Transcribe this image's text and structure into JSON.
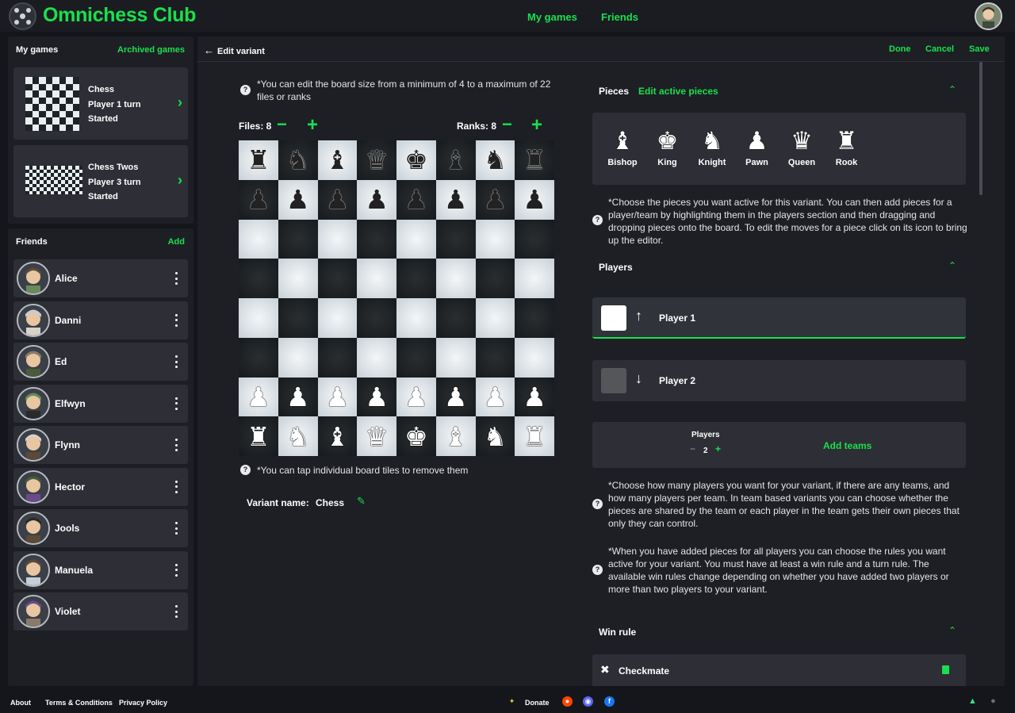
{
  "app": {
    "brand": "Omnichess Club",
    "nav": [
      "My games",
      "Friends"
    ],
    "accent": "#19e04c"
  },
  "my_games": {
    "title": "My games",
    "link": "Archived games",
    "games": [
      {
        "name": "Chess",
        "turn": "Player 1 turn",
        "status": "Started"
      },
      {
        "name": "Chess Twos",
        "turn": "Player 3 turn",
        "status": "Started"
      }
    ]
  },
  "friends": {
    "title": "Friends",
    "link": "Add",
    "list": [
      "Alice",
      "Danni",
      "Ed",
      "Elfwyn",
      "Flynn",
      "Hector",
      "Jools",
      "Manuela",
      "Violet"
    ]
  },
  "editor": {
    "back_label": "Edit variant",
    "done": "Done",
    "cancel": "Cancel",
    "save": "Save",
    "board_note": "*You can edit the board size from a minimum of 4 to a maximum of 22 files or ranks",
    "files_label": "Files: 8",
    "ranks_label": "Ranks: 8",
    "tile_note": "*You can tap individual board tiles to remove them",
    "variant_label": "Variant name:",
    "variant_value": "Chess",
    "board_rows": [
      [
        "♜",
        "♞",
        "♝",
        "♛",
        "♚",
        "♝",
        "♞",
        "♜"
      ],
      [
        "♟",
        "♟",
        "♟",
        "♟",
        "♟",
        "♟",
        "♟",
        "♟"
      ],
      [
        "",
        "",
        "",
        "",
        "",
        "",
        "",
        ""
      ],
      [
        "",
        "",
        "",
        "",
        "",
        "",
        "",
        ""
      ],
      [
        "",
        "",
        "",
        "",
        "",
        "",
        "",
        ""
      ],
      [
        "",
        "",
        "",
        "",
        "",
        "",
        "",
        ""
      ],
      [
        "♟",
        "♟",
        "♟",
        "♟",
        "♟",
        "♟",
        "♟",
        "♟"
      ],
      [
        "♜",
        "♞",
        "♝",
        "♛",
        "♚",
        "♝",
        "♞",
        "♜"
      ]
    ],
    "pieces_title": "Pieces",
    "pieces_link": "Edit active pieces",
    "pieces": [
      {
        "name": "Bishop",
        "glyph": "♝"
      },
      {
        "name": "King",
        "glyph": "♚"
      },
      {
        "name": "Knight",
        "glyph": "♞"
      },
      {
        "name": "Pawn",
        "glyph": "♟"
      },
      {
        "name": "Queen",
        "glyph": "♛"
      },
      {
        "name": "Rook",
        "glyph": "♜"
      }
    ],
    "pieces_note": "*Choose the pieces you want active for this variant. You can then add pieces for a player/team by highlighting them in the players section and then dragging and dropping pieces onto the board. To edit the moves for a piece click on its icon to bring up the editor.",
    "players_title": "Players",
    "players": [
      {
        "name": "Player 1",
        "arrow": "↑",
        "color": "#ffffff"
      },
      {
        "name": "Player 2",
        "arrow": "↓",
        "color": "#555659"
      }
    ],
    "players_count_label": "Players",
    "players_count": "2",
    "add_teams": "Add teams",
    "teams_note": "*Choose how many players you want for your variant, if there are any teams, and how many players per team. In team based variants you can choose whether the pieces are shared by the team or each player in the team gets their own pieces that only they can control.",
    "rules_note": "*When you have added pieces for all players you can choose the rules you want active for your variant. You must have at least a win rule and a turn rule. The available win rules change depending on whether you have added two players or more than two players to your variant.",
    "win_title": "Win rule",
    "win_rule": "Checkmate"
  },
  "footer": {
    "about": "About",
    "terms": "Terms & Conditions",
    "privacy": "Privacy Policy",
    "donate": "Donate"
  }
}
